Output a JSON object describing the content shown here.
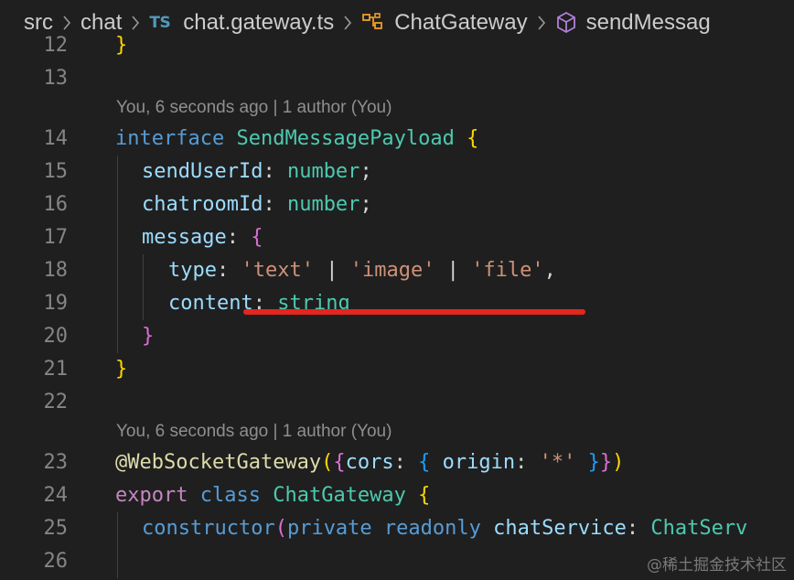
{
  "breadcrumb": {
    "items": [
      "src",
      "chat",
      "chat.gateway.ts",
      "ChatGateway",
      "sendMessag"
    ],
    "file_badge": "TS",
    "separator": ">"
  },
  "codelens": {
    "first": "You, 6 seconds ago | 1 author (You)",
    "second": "You, 6 seconds ago | 1 author (You)"
  },
  "line_numbers": [
    "12",
    "13",
    "14",
    "15",
    "16",
    "17",
    "18",
    "19",
    "20",
    "21",
    "22",
    "23",
    "24",
    "25",
    "26"
  ],
  "code": {
    "l12": {
      "brace": "}"
    },
    "l14": {
      "kw": "interface",
      "name": "SendMessagePayload",
      "brace": "{"
    },
    "l15": {
      "prop": "sendUserId",
      "colon": ":",
      "type": "number",
      "semi": ";"
    },
    "l16": {
      "prop": "chatroomId",
      "colon": ":",
      "type": "number",
      "semi": ";"
    },
    "l17": {
      "prop": "message",
      "colon": ":",
      "brace": "{"
    },
    "l18": {
      "prop": "type",
      "colon": ":",
      "s1": "'text'",
      "bar1": " | ",
      "s2": "'image'",
      "bar2": " | ",
      "s3": "'file'",
      "comma": ","
    },
    "l19": {
      "prop": "content",
      "colon": ":",
      "type": "string"
    },
    "l20": {
      "brace": "}"
    },
    "l21": {
      "brace": "}"
    },
    "l23": {
      "at": "@",
      "decorator": "WebSocketGateway",
      "p_open": "(",
      "b_open": "{",
      "key": "cors",
      "colon": ":",
      "in_open": "{",
      "key2": "origin",
      "colon2": ":",
      "str": "'*'",
      "in_close": "}",
      "b_close": "}",
      "p_close": ")"
    },
    "l24": {
      "kw1": "export",
      "kw2": "class",
      "name": "ChatGateway",
      "brace": "{"
    },
    "l25": {
      "kw": "constructor",
      "p_open": "(",
      "kw2": "private",
      "kw3": "readonly",
      "param": "chatService",
      "colon": ":",
      "type": "ChatServ"
    }
  },
  "watermark": "@稀土掘金技术社区",
  "colors": {
    "background": "#1f1f1f",
    "keyword": "#569cd6",
    "type": "#4ec9b0",
    "property": "#9cdcfe",
    "string": "#ce9178",
    "function": "#dcdcaa",
    "annotation_underline": "#e5261d"
  }
}
